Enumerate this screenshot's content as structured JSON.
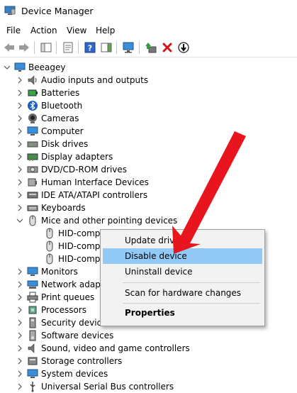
{
  "window": {
    "title": "Device Manager",
    "icon": "device-manager-icon"
  },
  "menu": [
    "File",
    "Action",
    "View",
    "Help"
  ],
  "toolbar": {
    "buttons": [
      "back-arrow-icon",
      "forward-arrow-icon",
      "show-hide-tree-icon",
      "properties-icon",
      "help-icon",
      "action-pane-icon",
      "scan-hardware-icon",
      "update-driver-icon",
      "uninstall-device-icon",
      "enable-device-icon"
    ]
  },
  "tree": {
    "root": "Beeagey",
    "categories": [
      {
        "label": "Audio inputs and outputs",
        "icon": "speaker-icon"
      },
      {
        "label": "Batteries",
        "icon": "battery-icon"
      },
      {
        "label": "Bluetooth",
        "icon": "bluetooth-icon"
      },
      {
        "label": "Cameras",
        "icon": "camera-icon"
      },
      {
        "label": "Computer",
        "icon": "computer-icon"
      },
      {
        "label": "Disk drives",
        "icon": "disk-drive-icon"
      },
      {
        "label": "Display adapters",
        "icon": "display-adapter-icon"
      },
      {
        "label": "DVD/CD-ROM drives",
        "icon": "dvd-drive-icon"
      },
      {
        "label": "Human Interface Devices",
        "icon": "hid-icon"
      },
      {
        "label": "IDE ATA/ATAPI controllers",
        "icon": "ide-controller-icon"
      },
      {
        "label": "Keyboards",
        "icon": "keyboard-icon"
      },
      {
        "label": "Mice and other pointing devices",
        "icon": "mouse-icon",
        "expanded": true
      }
    ],
    "mice_children": [
      "HID-compl",
      "HID-compl",
      "HID-compl"
    ],
    "after": [
      {
        "label": "Monitors",
        "icon": "monitor-icon"
      },
      {
        "label": "Network adapt",
        "icon": "network-adapter-icon"
      },
      {
        "label": "Print queues",
        "icon": "printer-icon"
      },
      {
        "label": "Processors",
        "icon": "processor-icon"
      },
      {
        "label": "Security devices",
        "icon": "security-device-icon"
      },
      {
        "label": "Software devices",
        "icon": "software-device-icon"
      },
      {
        "label": "Sound, video and game controllers",
        "icon": "sound-controller-icon"
      },
      {
        "label": "Storage controllers",
        "icon": "storage-controller-icon"
      },
      {
        "label": "System devices",
        "icon": "system-device-icon"
      },
      {
        "label": "Universal Serial Bus controllers",
        "icon": "usb-icon"
      }
    ]
  },
  "context_menu": {
    "items": [
      "Update driver",
      "Disable device",
      "Uninstall device",
      "Scan for hardware changes",
      "Properties"
    ],
    "highlighted": "Disable device"
  },
  "colors": {
    "highlight": "#91c9f7",
    "arrow": "#e8141e",
    "menu_bg": "#f2f2f2"
  }
}
